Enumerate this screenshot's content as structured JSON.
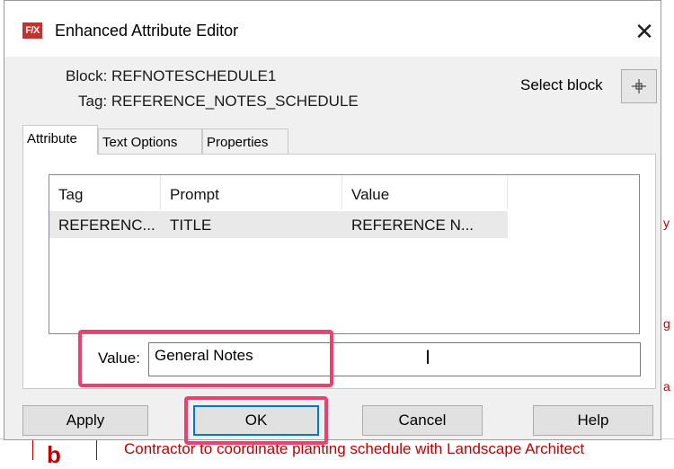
{
  "window": {
    "title": "Enhanced Attribute Editor",
    "app_icon_text": "F/X",
    "close_label": "✕"
  },
  "info": {
    "block": "Block: REFNOTESCHEDULE1",
    "tag": "Tag: REFERENCE_NOTES_SCHEDULE",
    "select_label": "Select block"
  },
  "tabs": [
    {
      "label": "Attribute",
      "active": true
    },
    {
      "label": "Text Options",
      "active": false
    },
    {
      "label": "Properties",
      "active": false
    }
  ],
  "table": {
    "headers": [
      "Tag",
      "Prompt",
      "Value"
    ],
    "rows": [
      [
        "REFERENC...",
        "TITLE",
        "REFERENCE N..."
      ]
    ]
  },
  "value_field": {
    "label": "Value:",
    "value": "General Notes"
  },
  "buttons": {
    "apply": "Apply",
    "ok": "OK",
    "cancel": "Cancel",
    "help": "Help"
  },
  "background": {
    "note_number": "b",
    "note_text": "Contractor to coordinate planting schedule with Landscape Architect",
    "right_marks": [
      "y",
      "g",
      "a"
    ]
  },
  "colors": {
    "highlight": "#ee3f6e",
    "cad_red": "#c00000",
    "default_button_border": "#0078d7"
  }
}
